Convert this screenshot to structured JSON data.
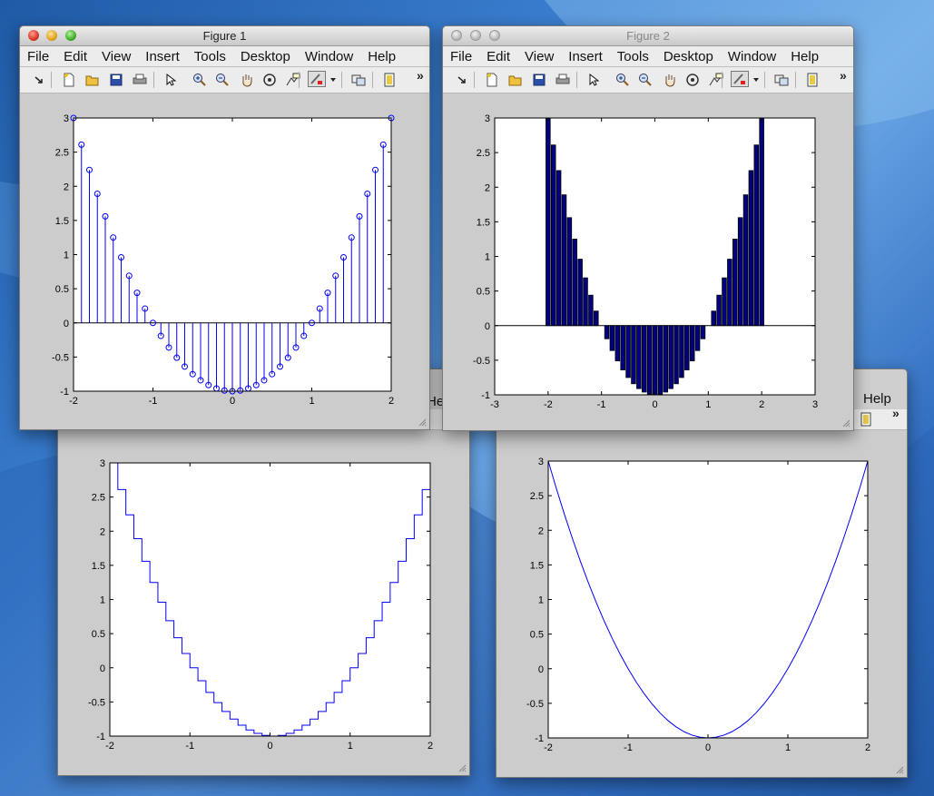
{
  "windows": {
    "fig1": {
      "title": "Figure 1",
      "active": true
    },
    "fig2": {
      "title": "Figure 2",
      "active": false
    },
    "fig3": {
      "menu_partial": "He"
    },
    "fig4": {
      "menu_partial": "Help"
    }
  },
  "menu": [
    "File",
    "Edit",
    "View",
    "Insert",
    "Tools",
    "Desktop",
    "Window",
    "Help"
  ],
  "toolbar": {
    "icons": [
      "dock-arrow-icon",
      "new-figure-icon",
      "open-file-icon",
      "save-icon",
      "print-icon",
      "pointer-icon",
      "zoom-in-icon",
      "zoom-out-icon",
      "pan-hand-icon",
      "rotate-3d-icon",
      "data-cursor-icon",
      "brush-icon",
      "brush-dropdown-icon",
      "link-plot-icon",
      "colorbar-icon"
    ],
    "overflow_label": "»"
  },
  "colors": {
    "line": "#0000ff",
    "bar_fill": "#000080",
    "axes_bg": "#ffffff",
    "figure_bg": "#cccccc"
  },
  "chart_data": [
    {
      "type": "stem",
      "window": "Figure 1",
      "x": [
        -2,
        -1.9,
        -1.8,
        -1.7,
        -1.6,
        -1.5,
        -1.4,
        -1.3,
        -1.2,
        -1.1,
        -1,
        -0.9,
        -0.8,
        -0.7,
        -0.6,
        -0.5,
        -0.4,
        -0.3,
        -0.2,
        -0.1,
        0,
        0.1,
        0.2,
        0.3,
        0.4,
        0.5,
        0.6,
        0.7,
        0.8,
        0.9,
        1,
        1.1,
        1.2,
        1.3,
        1.4,
        1.5,
        1.6,
        1.7,
        1.8,
        1.9,
        2
      ],
      "function": "y = x^2 - 1",
      "xlim": [
        -2,
        2
      ],
      "ylim": [
        -1,
        3
      ],
      "xticks": [
        "-2",
        "-1",
        "0",
        "1",
        "2"
      ],
      "yticks": [
        "-1",
        "-0.5",
        "0",
        "0.5",
        "1",
        "1.5",
        "2",
        "2.5",
        "3"
      ]
    },
    {
      "type": "bar",
      "window": "Figure 2",
      "x": [
        -2,
        -1.9,
        -1.8,
        -1.7,
        -1.6,
        -1.5,
        -1.4,
        -1.3,
        -1.2,
        -1.1,
        -1,
        -0.9,
        -0.8,
        -0.7,
        -0.6,
        -0.5,
        -0.4,
        -0.3,
        -0.2,
        -0.1,
        0,
        0.1,
        0.2,
        0.3,
        0.4,
        0.5,
        0.6,
        0.7,
        0.8,
        0.9,
        1,
        1.1,
        1.2,
        1.3,
        1.4,
        1.5,
        1.6,
        1.7,
        1.8,
        1.9,
        2
      ],
      "function": "y = x^2 - 1",
      "xlim": [
        -3,
        3
      ],
      "ylim": [
        -1,
        3
      ],
      "xticks": [
        "-3",
        "-2",
        "-1",
        "0",
        "1",
        "2",
        "3"
      ],
      "yticks": [
        "-1",
        "-0.5",
        "0",
        "0.5",
        "1",
        "1.5",
        "2",
        "2.5",
        "3"
      ]
    },
    {
      "type": "stairs",
      "window": "Figure 3",
      "x": [
        -2,
        -1.9,
        -1.8,
        -1.7,
        -1.6,
        -1.5,
        -1.4,
        -1.3,
        -1.2,
        -1.1,
        -1,
        -0.9,
        -0.8,
        -0.7,
        -0.6,
        -0.5,
        -0.4,
        -0.3,
        -0.2,
        -0.1,
        0,
        0.1,
        0.2,
        0.3,
        0.4,
        0.5,
        0.6,
        0.7,
        0.8,
        0.9,
        1,
        1.1,
        1.2,
        1.3,
        1.4,
        1.5,
        1.6,
        1.7,
        1.8,
        1.9,
        2
      ],
      "function": "y = x^2 - 1",
      "xlim": [
        -2,
        2
      ],
      "ylim": [
        -1,
        3
      ],
      "xticks": [
        "-2",
        "-1",
        "0",
        "1",
        "2"
      ],
      "yticks": [
        "-1",
        "-0.5",
        "0",
        "0.5",
        "1",
        "1.5",
        "2",
        "2.5",
        "3"
      ]
    },
    {
      "type": "line",
      "window": "Figure 4",
      "x": [
        -2,
        -1.9,
        -1.8,
        -1.7,
        -1.6,
        -1.5,
        -1.4,
        -1.3,
        -1.2,
        -1.1,
        -1,
        -0.9,
        -0.8,
        -0.7,
        -0.6,
        -0.5,
        -0.4,
        -0.3,
        -0.2,
        -0.1,
        0,
        0.1,
        0.2,
        0.3,
        0.4,
        0.5,
        0.6,
        0.7,
        0.8,
        0.9,
        1,
        1.1,
        1.2,
        1.3,
        1.4,
        1.5,
        1.6,
        1.7,
        1.8,
        1.9,
        2
      ],
      "function": "y = x^2 - 1",
      "xlim": [
        -2,
        2
      ],
      "ylim": [
        -1,
        3
      ],
      "xticks": [
        "-2",
        "-1",
        "0",
        "1",
        "2"
      ],
      "yticks": [
        "-1",
        "-0.5",
        "0",
        "0.5",
        "1",
        "1.5",
        "2",
        "2.5",
        "3"
      ]
    }
  ]
}
